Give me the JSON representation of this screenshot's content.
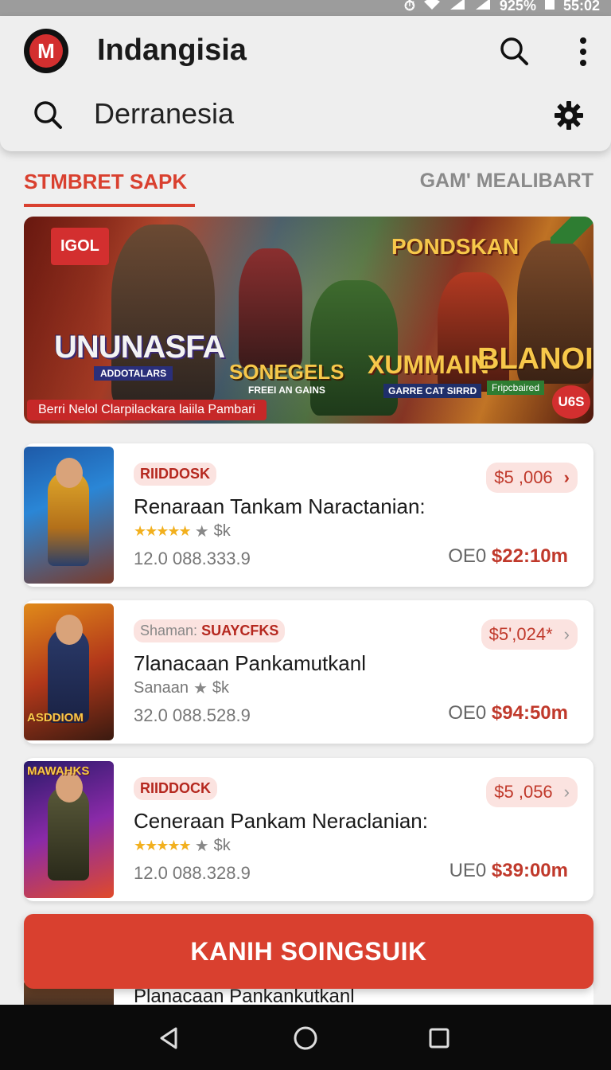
{
  "status_bar": {
    "battery": "925%",
    "time": "55:02"
  },
  "app_bar": {
    "logo_letter": "M",
    "title": "Indangisia",
    "search_icon": "search-icon",
    "menu_icon": "more-vert-icon",
    "search_query": "Derranesia",
    "settings_icon": "gear-icon"
  },
  "tabs": {
    "active": "STMBRET SAPK",
    "inactive": "GAM' MEALIBART"
  },
  "banner": {
    "badge": "IGOL",
    "title_left": "UNUNASFA",
    "sub_left": "ADDOTALARS",
    "title_top_right": "PONDSKAN",
    "title_mid": "SONEGELS",
    "sub_mid": "FREEI AN GAINS",
    "title_x": "XUMMAIN",
    "sub_x": "GARRE CAT SIRRD",
    "title_right": "BLANOII",
    "sub_right": "Fripcbaired",
    "caption": "Berri Nelol Clarpilackara laiila Pambari",
    "corner_badge": "U6S"
  },
  "cards": [
    {
      "tag": "RIIDDOSK",
      "tag_prefix": "",
      "price": "$5 ,006",
      "title": "Renaraan Tankam Naractanian:",
      "rating_text": "$k",
      "meta": "12.0 088.333.9",
      "total_label": "OE0",
      "total_value": "$22:10m",
      "thumb_label": ""
    },
    {
      "tag": "SUAYCFKS",
      "tag_prefix": "Shaman:",
      "price": "$5',024*",
      "title": "7lanacaan Pankamutkanl",
      "rating_text": "$k",
      "rating_prefix": "Sanaan",
      "meta": "32.0 088.528.9",
      "total_label": "OE0",
      "total_value": "$94:50m",
      "thumb_label": "ASDDIOM"
    },
    {
      "tag": "RIIDDOCK",
      "tag_prefix": "",
      "price": "$5 ,056",
      "title": "Ceneraan Pankam Neraclanian:",
      "rating_text": "$k",
      "meta": "12.0 088.328.9",
      "total_label": "UE0",
      "total_value": "$39:00m",
      "thumb_label": "MAWAHKS"
    }
  ],
  "partial_card": {
    "title": "Planacaan Pankankutkanl"
  },
  "cta": {
    "label": "KANIH SOINGSUIK"
  },
  "colors": {
    "accent": "#d9402f",
    "price_bg": "#fbe3e0",
    "star": "#f2b01e"
  }
}
